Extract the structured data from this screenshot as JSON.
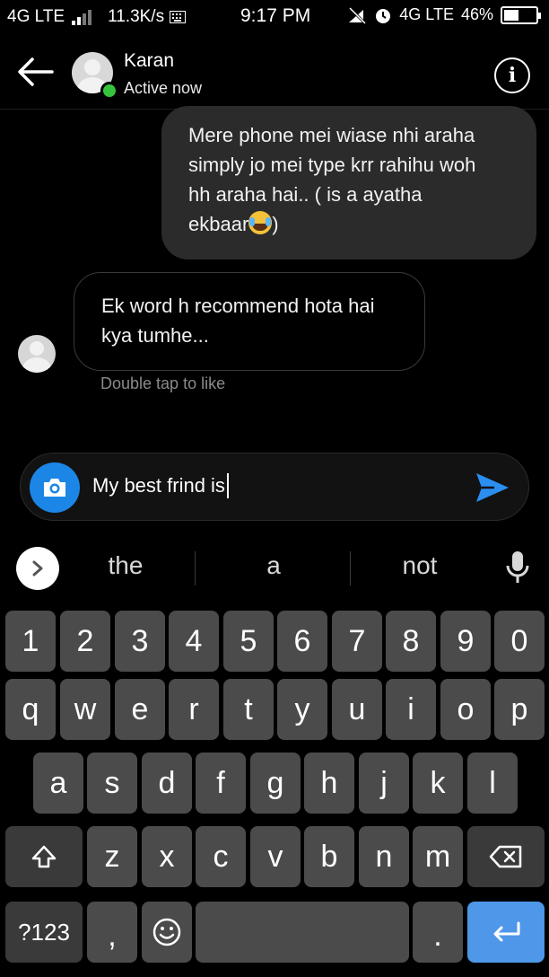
{
  "status_bar": {
    "network_left": "4G LTE",
    "speed": "11.3K/s",
    "time": "9:17 PM",
    "network_right": "4G LTE",
    "battery": "46%",
    "battery_level": 0.46
  },
  "header": {
    "contact_name": "Karan",
    "contact_status": "Active now",
    "info_icon": "i"
  },
  "messages": [
    {
      "direction": "outgoing",
      "lines": [
        "Mere phone mei wiase nhi araha",
        "simply jo mei type krr rahihu woh",
        "hh araha hai.. ( is a ayatha",
        "ekbaar"
      ],
      "emoji": "face-with-tears-of-joy",
      "tail": ")"
    },
    {
      "direction": "incoming",
      "lines": [
        "Ek word h recommend hota hai",
        "kya tumhe..."
      ]
    }
  ],
  "hint": "Double tap to like",
  "composer": {
    "input_value": "My best frind is"
  },
  "suggestions": [
    "the",
    "a",
    "not"
  ],
  "keyboard": {
    "numbers": [
      "1",
      "2",
      "3",
      "4",
      "5",
      "6",
      "7",
      "8",
      "9",
      "0"
    ],
    "row1": [
      "q",
      "w",
      "e",
      "r",
      "t",
      "y",
      "u",
      "i",
      "o",
      "p"
    ],
    "row2": [
      "a",
      "s",
      "d",
      "f",
      "g",
      "h",
      "j",
      "k",
      "l"
    ],
    "row3": [
      "z",
      "x",
      "c",
      "v",
      "b",
      "n",
      "m"
    ],
    "symbols_label": "?123",
    "comma": ",",
    "period": "."
  },
  "colors": {
    "accent_blue": "#1b86e6",
    "enter_key": "#4e97e9",
    "online_green": "#36c43c",
    "key_bg": "#4b4b4b"
  }
}
